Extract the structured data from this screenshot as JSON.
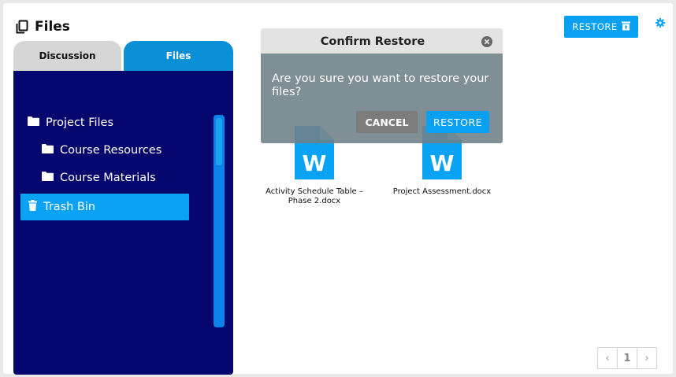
{
  "header": {
    "title": "Files",
    "icon": "copy-icon",
    "restore_label": "RESTORE",
    "restore_icon": "trash-restore-icon",
    "settings_icon": "gear-icon"
  },
  "tabs": [
    {
      "label": "Discussion",
      "active": false
    },
    {
      "label": "Files",
      "active": true
    }
  ],
  "sidebar": {
    "items": [
      {
        "label": "Project Files",
        "icon": "folder-icon"
      },
      {
        "label": "Course Resources",
        "icon": "folder-icon"
      },
      {
        "label": "Course Materials",
        "icon": "folder-icon"
      },
      {
        "label": "Trash Bin",
        "icon": "trash-icon",
        "selected": true
      }
    ]
  },
  "files": [
    {
      "name": "Activity Schedule Table – Phase 2.docx",
      "icon": "word-doc-icon",
      "badge": "W"
    },
    {
      "name": "Project Assessment.docx",
      "icon": "word-doc-icon",
      "badge": "W"
    }
  ],
  "dialog": {
    "title": "Confirm Restore",
    "message": "Are you sure you want to restore your files?",
    "cancel_label": "CANCEL",
    "confirm_label": "RESTORE"
  },
  "pagination": {
    "prev": "‹",
    "page": "1",
    "next": "›"
  },
  "colors": {
    "accent": "#09a0f2",
    "sidebar_bg": "#06066f",
    "word_blue": "#0aa2f5"
  }
}
